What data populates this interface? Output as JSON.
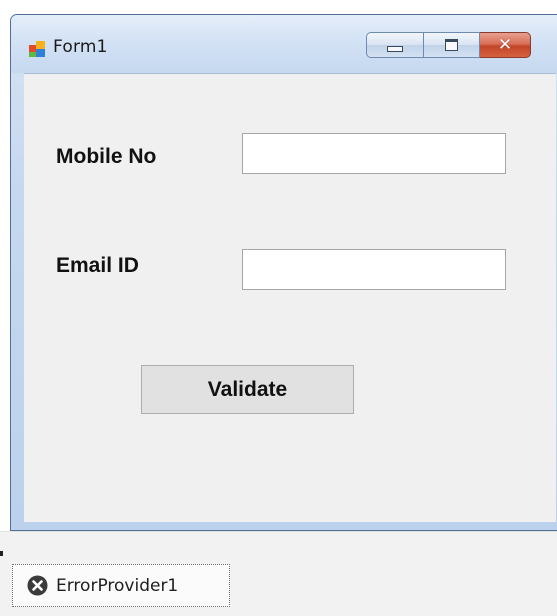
{
  "window": {
    "title": "Form1",
    "icon": "winforms-app-icon",
    "controls": {
      "minimize": "minimize-icon",
      "maximize": "maximize-icon",
      "close": "close-icon"
    }
  },
  "form": {
    "mobile_label": "Mobile No",
    "mobile_value": "",
    "email_label": "Email ID",
    "email_value": "",
    "validate_label": "Validate"
  },
  "tray": {
    "component_label": "ErrorProvider1",
    "component_icon": "error-circle-icon"
  },
  "colors": {
    "titlebar": "#d3e2f5",
    "client_bg": "#f0f0f0",
    "close_button": "#c4452a"
  }
}
